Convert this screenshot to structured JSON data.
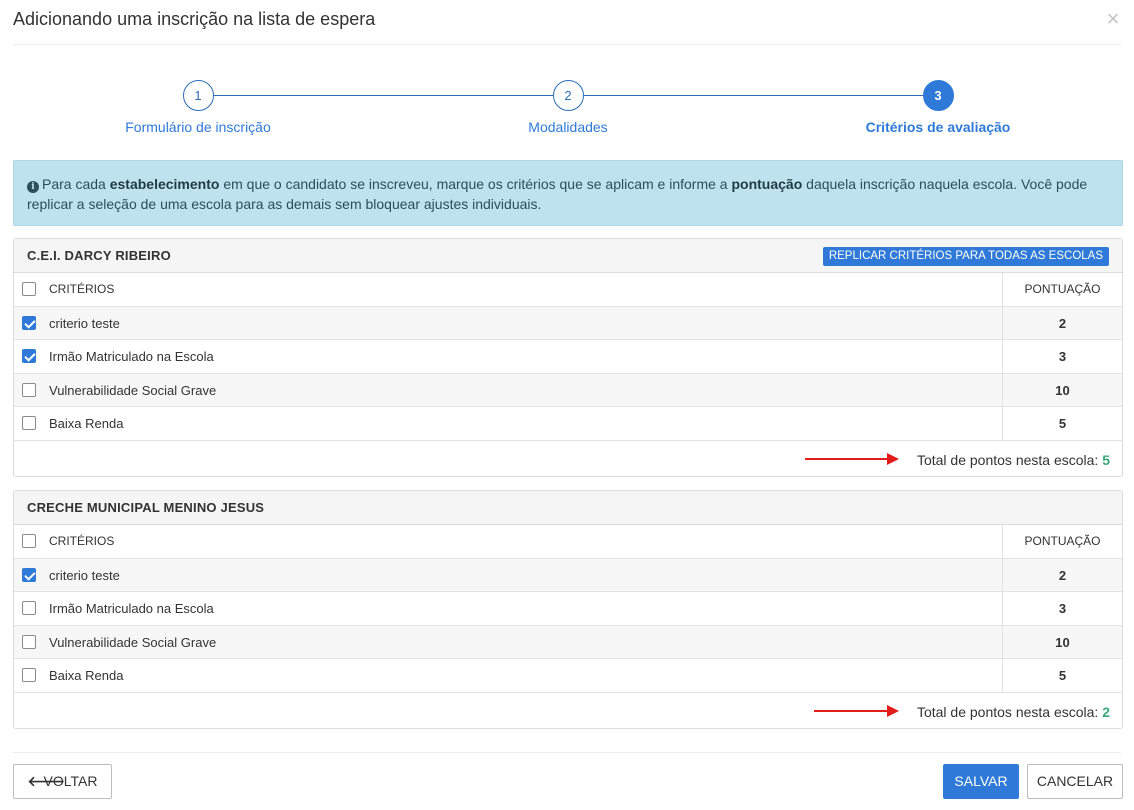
{
  "modal": {
    "title": "Adicionando uma inscrição na lista de espera",
    "close_glyph": "×"
  },
  "stepper": {
    "steps": [
      {
        "number": "1",
        "label": "Formulário de inscrição",
        "active": false
      },
      {
        "number": "2",
        "label": "Modalidades",
        "active": false
      },
      {
        "number": "3",
        "label": "Critérios de avaliação",
        "active": true
      }
    ]
  },
  "info": {
    "icon": "info-icon",
    "part1": "Para cada ",
    "bold1": "estabelecimento",
    "part2": " em que o candidato se inscreveu, marque os critérios que se aplicam e informe a ",
    "bold2": "pontuação",
    "part3": " daquela inscrição naquela escola. Você pode replicar a seleção de uma escola para as demais sem bloquear ajustes individuais."
  },
  "schools": [
    {
      "name": "C.E.I. DARCY RIBEIRO",
      "replicate_label": "REPLICAR CRITÉRIOS PARA TODAS AS ESCOLAS",
      "col_criteria": "CRITÉRIOS",
      "col_score": "PONTUAÇÃO",
      "criteria": [
        {
          "name": "criterio teste",
          "score": "2",
          "checked": true
        },
        {
          "name": "Irmão Matriculado na Escola",
          "score": "3",
          "checked": true
        },
        {
          "name": "Vulnerabilidade Social Grave",
          "score": "10",
          "checked": false
        },
        {
          "name": "Baixa Renda",
          "score": "5",
          "checked": false
        }
      ],
      "total_label": "Total de pontos nesta escola: ",
      "total_value": "5"
    },
    {
      "name": "CRECHE MUNICIPAL MENINO JESUS",
      "col_criteria": "CRITÉRIOS",
      "col_score": "PONTUAÇÃO",
      "criteria": [
        {
          "name": "criterio teste",
          "score": "2",
          "checked": true
        },
        {
          "name": "Irmão Matriculado na Escola",
          "score": "3",
          "checked": false
        },
        {
          "name": "Vulnerabilidade Social Grave",
          "score": "10",
          "checked": false
        },
        {
          "name": "Baixa Renda",
          "score": "5",
          "checked": false
        }
      ],
      "total_label": "Total de pontos nesta escola: ",
      "total_value": "2"
    }
  ],
  "footer": {
    "back_icon": "arrow-left-icon",
    "back_label": "VOLTAR",
    "save_label": "SALVAR",
    "cancel_label": "CANCELAR"
  },
  "colors": {
    "primary": "#2f7ad8",
    "info_bg": "#bfe3ee",
    "total_value": "#3aa87a",
    "annotation_arrow": "#e21b1b"
  }
}
